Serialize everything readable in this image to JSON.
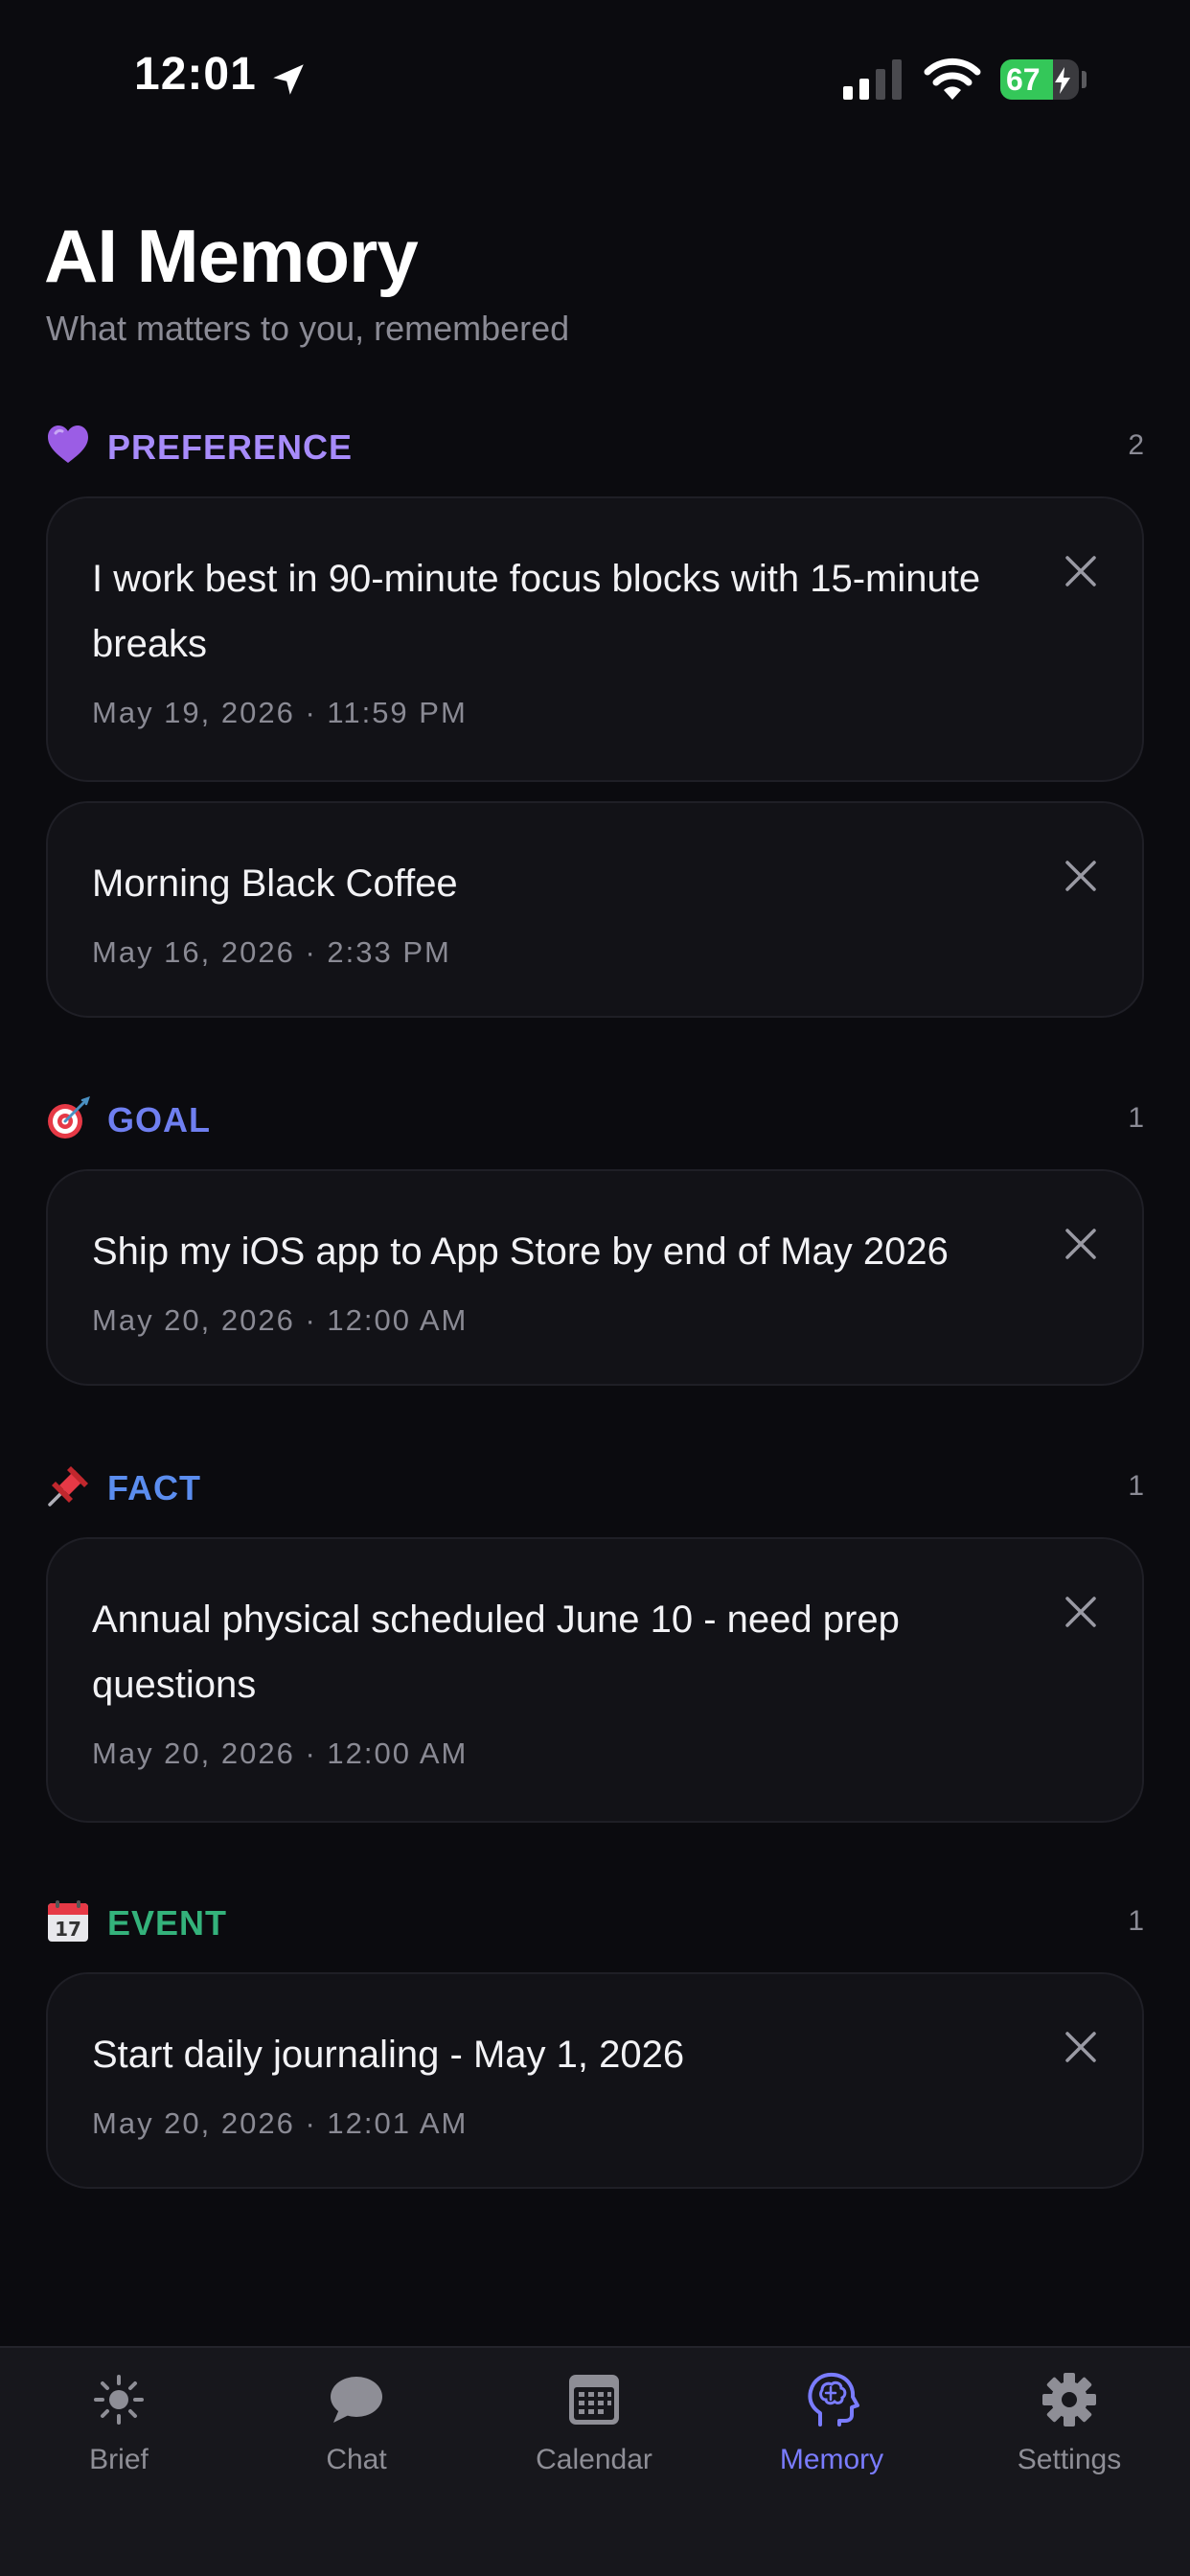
{
  "status_bar": {
    "time": "12:01",
    "battery_level": "67",
    "battery_fraction": 0.67
  },
  "header": {
    "title": "AI Memory",
    "subtitle": "What matters to you, remembered"
  },
  "sections": [
    {
      "title": "PREFERENCE",
      "count": "2",
      "icon": "purple-heart-icon",
      "color": "#a78bfa",
      "items": [
        {
          "text": "I work best in 90-minute focus blocks with 15-minute breaks",
          "date": "May 19, 2026 · 11:59 PM"
        },
        {
          "text": "Morning Black Coffee",
          "date": "May 16, 2026 · 2:33 PM"
        }
      ]
    },
    {
      "title": "GOAL",
      "count": "1",
      "icon": "direct-hit-target-icon",
      "color": "#6f7ff0",
      "items": [
        {
          "text": "Ship my iOS app to App Store by end of May 2026",
          "date": "May 20, 2026 · 12:00 AM"
        }
      ]
    },
    {
      "title": "FACT",
      "count": "1",
      "icon": "pushpin-icon",
      "color": "#5b8def",
      "items": [
        {
          "text": "Annual physical scheduled June 10 - need prep questions",
          "date": "May 20, 2026 · 12:00 AM"
        }
      ]
    },
    {
      "title": "EVENT",
      "count": "1",
      "icon": "calendar-17-icon",
      "color": "#34b27b",
      "items": [
        {
          "text": "Start daily journaling - May 1, 2026",
          "date": "May 20, 2026 · 12:01 AM"
        }
      ]
    }
  ],
  "tab_bar": {
    "tabs": [
      {
        "label": "Brief",
        "icon": "sun-icon"
      },
      {
        "label": "Chat",
        "icon": "chat-bubble-icon"
      },
      {
        "label": "Calendar",
        "icon": "calendar-icon"
      },
      {
        "label": "Memory",
        "icon": "brain-head-icon",
        "active": true
      },
      {
        "label": "Settings",
        "icon": "gear-icon"
      }
    ],
    "active_color": "#7a7cff",
    "inactive_color": "#8e8e96"
  }
}
